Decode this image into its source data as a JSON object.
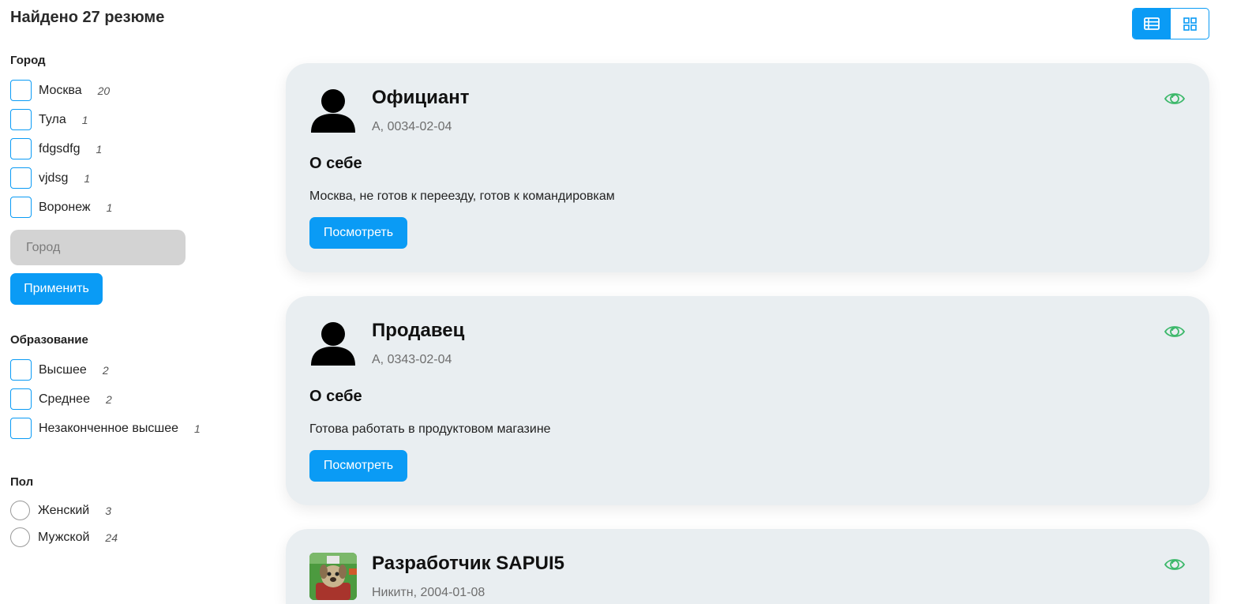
{
  "header": {
    "title": "Найдено 27 резюме"
  },
  "filters": {
    "city": {
      "title": "Город",
      "options": [
        {
          "label": "Москва",
          "count": "20"
        },
        {
          "label": "Тула",
          "count": "1"
        },
        {
          "label": "fdgsdfg",
          "count": "1"
        },
        {
          "label": "vjdsg",
          "count": "1"
        },
        {
          "label": "Воронеж",
          "count": "1"
        }
      ],
      "input_placeholder": "Город",
      "apply_label": "Применить"
    },
    "education": {
      "title": "Образование",
      "options": [
        {
          "label": "Высшее",
          "count": "2"
        },
        {
          "label": "Среднее",
          "count": "2"
        },
        {
          "label": "Незаконченное высшее",
          "count": "1"
        }
      ]
    },
    "gender": {
      "title": "Пол",
      "options": [
        {
          "label": "Женский",
          "count": "3"
        },
        {
          "label": "Мужской",
          "count": "24"
        }
      ]
    }
  },
  "view_toggle": {
    "active": "list",
    "icons": [
      "list-view-icon",
      "grid-view-icon"
    ]
  },
  "resumes": [
    {
      "title": "Официант",
      "meta": "А, 0034-02-04",
      "about_heading": "О себе",
      "about": "Москва, не готов к переезду, готов к командировкам",
      "button": "Посмотреть",
      "avatar": "person-silhouette-icon"
    },
    {
      "title": "Продавец",
      "meta": "А, 0343-02-04",
      "about_heading": "О себе",
      "about": "Готова работать в продуктовом магазине",
      "button": "Посмотреть",
      "avatar": "person-silhouette-icon"
    },
    {
      "title": "Разработчик SAPUI5",
      "meta": "Никитн, 2004-01-08",
      "avatar": "user-photo"
    }
  ],
  "colors": {
    "accent": "#0a9bf5",
    "card_bg": "#e9eef1",
    "eye": "#3cb86a",
    "input_bg": "#d3d3d3"
  }
}
